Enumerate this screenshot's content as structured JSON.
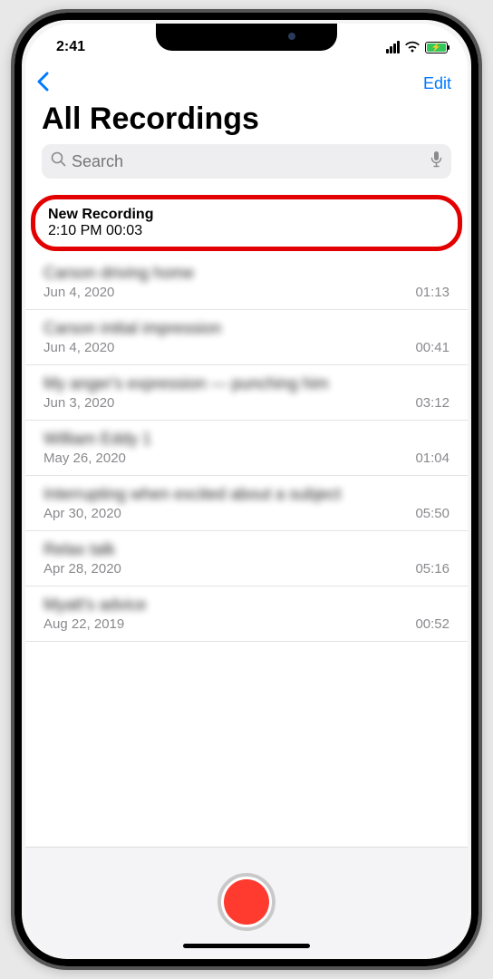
{
  "status": {
    "time": "2:41"
  },
  "nav": {
    "edit": "Edit"
  },
  "title": "All Recordings",
  "search": {
    "placeholder": "Search"
  },
  "recordings": [
    {
      "name": "New Recording",
      "date": "2:10 PM",
      "duration": "00:03",
      "highlighted": true
    },
    {
      "name": "Carson driving home",
      "date": "Jun 4, 2020",
      "duration": "01:13",
      "blurred": true
    },
    {
      "name": "Carson initial impression",
      "date": "Jun 4, 2020",
      "duration": "00:41",
      "blurred": true
    },
    {
      "name": "My anger's expression — punching him",
      "date": "Jun 3, 2020",
      "duration": "03:12",
      "blurred": true
    },
    {
      "name": "William Eddy 1",
      "date": "May 26, 2020",
      "duration": "01:04",
      "blurred": true
    },
    {
      "name": "Interrupting when excited about a subject",
      "date": "Apr 30, 2020",
      "duration": "05:50",
      "blurred": true
    },
    {
      "name": "Relax talk",
      "date": "Apr 28, 2020",
      "duration": "05:16",
      "blurred": true
    },
    {
      "name": "Myatt's advice",
      "date": "Aug 22, 2019",
      "duration": "00:52",
      "blurred": true
    }
  ]
}
